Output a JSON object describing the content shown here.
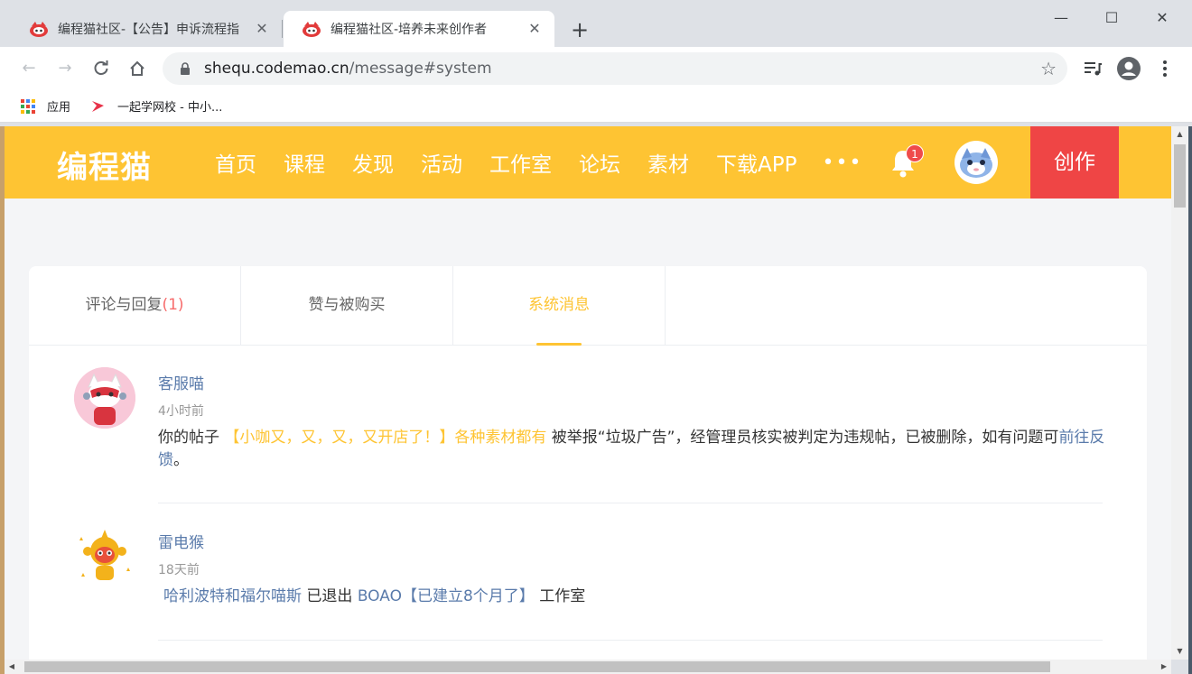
{
  "browser": {
    "tabs": [
      {
        "title": "编程猫社区-【公告】申诉流程指",
        "icon": "codemao-favicon",
        "active": false
      },
      {
        "title": "编程猫社区-培养未来创作者",
        "icon": "codemao-favicon",
        "active": true
      }
    ],
    "new_tab": "+",
    "url_host": "shequ.codemao.cn",
    "url_path": "/message#system",
    "bookmarks": [
      {
        "label": "应用",
        "icon": "apps-grid-icon"
      },
      {
        "label": "一起学网校 - 中小...",
        "icon": "17zuoye-icon"
      }
    ]
  },
  "site": {
    "logo": "编程猫",
    "nav": [
      "首页",
      "课程",
      "发现",
      "活动",
      "工作室",
      "论坛",
      "素材",
      "下载APP"
    ],
    "more": "•••",
    "notification_count": "1",
    "create_label": "创作"
  },
  "message_tabs": [
    {
      "label": "评论与回复",
      "count": "(1)"
    },
    {
      "label": "赞与被购买",
      "count": ""
    },
    {
      "label": "系统消息",
      "count": "",
      "active": true
    }
  ],
  "messages": [
    {
      "sender": "客服喵",
      "time": "4小时前",
      "prefix": "你的帖子 ",
      "post_title": "【小咖又，又，又，又开店了！】各种素材都有",
      "mid": " 被举报“垃圾广告”，经管理员核实被判定为违规帖，已被删除，如有问题可",
      "link": "前往反馈",
      "suffix": "。"
    },
    {
      "sender": "雷电猴",
      "time": "18天前",
      "user": "哈利波特和福尔喵斯",
      "action": " 已退出 ",
      "studio": "BOAO【已建立8个月了】",
      "tail": " 工作室"
    }
  ],
  "colors": {
    "brand_yellow": "#fec433",
    "create_red": "#ef4545",
    "link_blue": "#5a7bab"
  }
}
